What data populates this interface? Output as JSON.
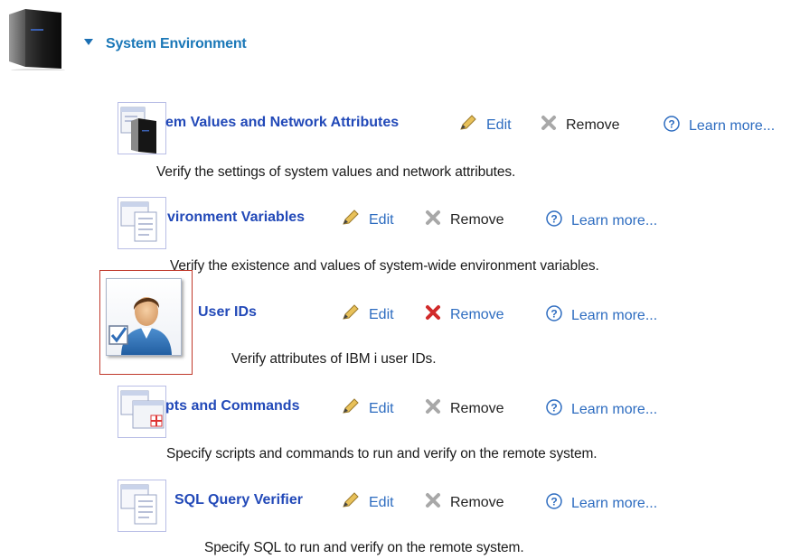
{
  "section": {
    "title": "System Environment",
    "icon": "server-tower-icon",
    "expand_icon": "triangle-down-icon"
  },
  "actions": {
    "edit_label": "Edit",
    "remove_label": "Remove",
    "learn_more_label": "Learn more..."
  },
  "items": [
    {
      "title": "em Values and Network Attributes",
      "description": "Verify the settings of system values and network attributes.",
      "icon": "system-values-icon"
    },
    {
      "title": "vironment Variables",
      "description": "Verify the existence and values of system-wide environment variables.",
      "icon": "document-window-icon"
    },
    {
      "title": "User IDs",
      "description": "Verify attributes of IBM i user IDs.",
      "icon": "user-checkbox-icon",
      "selected": true
    },
    {
      "title": "pts and Commands",
      "description": "Specify scripts and commands to run and verify on the remote system.",
      "icon": "script-window-icon"
    },
    {
      "title": "SQL Query Verifier",
      "description": "Specify SQL to run and verify on the remote system.",
      "icon": "document-window-icon"
    }
  ],
  "colors": {
    "section_title": "#1b78b8",
    "item_title": "#2249b8",
    "link": "#2d6cc0",
    "remove_active": "#d12a2a",
    "remove_inactive": "#a0a0a0",
    "selection_border": "#c0392b"
  }
}
